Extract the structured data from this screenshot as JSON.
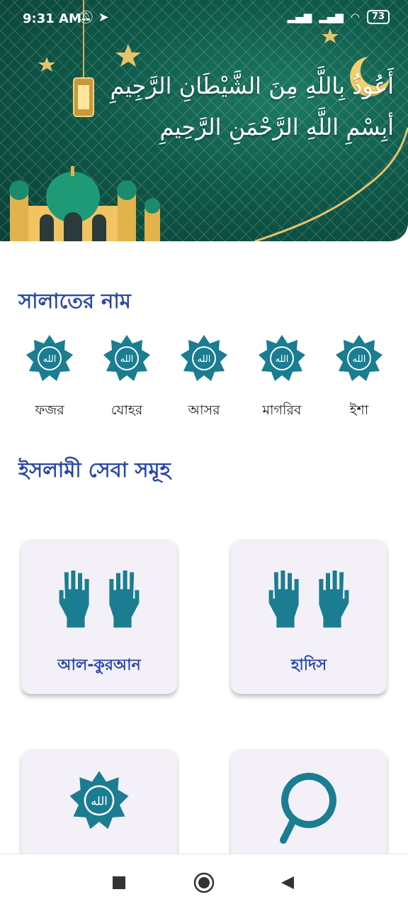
{
  "status_bar": {
    "time": "9:31 AM",
    "battery": "73",
    "icons": [
      "mute-bell-icon",
      "send-icon",
      "signal-icon",
      "signal-icon",
      "wifi-icon",
      "battery-icon"
    ]
  },
  "banner": {
    "line1": "أَعُوذُ بِاللَّهِ مِنَ الشَّيْطَانِ الرَّجِيمِ",
    "line2": "أبِسْمِ اللَّهِ الرَّحْمَنِ الرَّحِيمِ"
  },
  "prayer_section": {
    "title": "সালাতের নাম",
    "items": [
      {
        "label": "ফজর",
        "icon": "allah-emblem-icon"
      },
      {
        "label": "যোহর",
        "icon": "allah-emblem-icon"
      },
      {
        "label": "আসর",
        "icon": "allah-emblem-icon"
      },
      {
        "label": "মাগরিব",
        "icon": "allah-emblem-icon"
      },
      {
        "label": "ইশা",
        "icon": "allah-emblem-icon"
      }
    ]
  },
  "services_section": {
    "title": "ইসলামী সেবা সমূহ",
    "cards": [
      {
        "label": "আল-কুরআন",
        "icon": "praying-hands-icon"
      },
      {
        "label": "হাদিস",
        "icon": "praying-hands-icon"
      },
      {
        "label": "",
        "icon": "allah-emblem-icon"
      },
      {
        "label": "",
        "icon": "tasbih-beads-icon"
      }
    ]
  },
  "nav_bar": {
    "icons": [
      "recent-apps-icon",
      "home-icon",
      "back-icon"
    ]
  },
  "colors": {
    "accent": "#2b48a8",
    "icon_teal": "#1a7d92",
    "banner_green": "#0f5a4a",
    "card_bg": "#f3f0f7"
  }
}
